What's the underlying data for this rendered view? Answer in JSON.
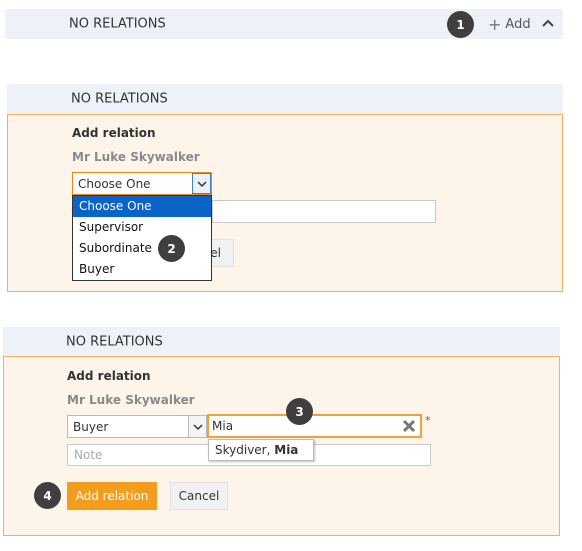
{
  "section1": {
    "title": "NO RELATIONS",
    "add_label": "Add",
    "step": "1"
  },
  "section2": {
    "title": "NO RELATIONS",
    "form_title": "Add relation",
    "person": "Mr Luke Skywalker",
    "select_value": "Choose One",
    "options": [
      "Choose One",
      "Supervisor",
      "Subordinate",
      "Buyer"
    ],
    "hidden_button_tail": "el",
    "step": "2"
  },
  "section3": {
    "title": "NO RELATIONS",
    "form_title": "Add relation",
    "person": "Mr Luke Skywalker",
    "select_value": "Buyer",
    "search_value": "Mia",
    "required_mark": "*",
    "suggestion_prefix": "Skydiver, ",
    "suggestion_match": "Mia",
    "note_placeholder": "Note",
    "add_button": "Add relation",
    "cancel_button": "Cancel",
    "step_search": "3",
    "step_add": "4"
  },
  "colors": {
    "accent": "#f49c1e",
    "panel_bg": "#fdf4ea",
    "header_bg": "#eef2f8",
    "selected_option": "#0a64c8"
  }
}
